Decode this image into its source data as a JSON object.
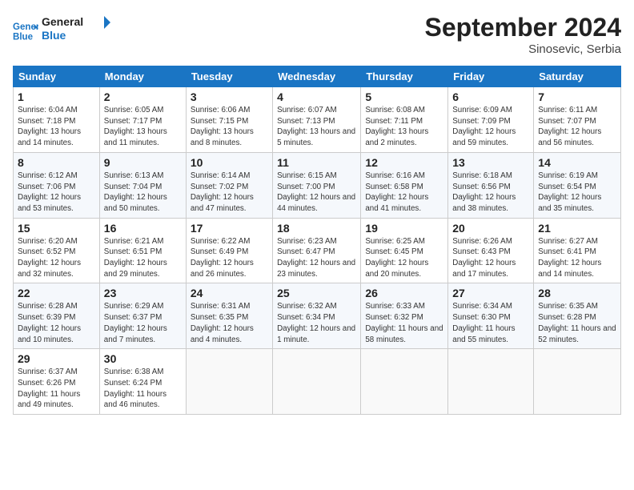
{
  "header": {
    "logo_line1": "General",
    "logo_line2": "Blue",
    "month": "September 2024",
    "location": "Sinosevic, Serbia"
  },
  "days_of_week": [
    "Sunday",
    "Monday",
    "Tuesday",
    "Wednesday",
    "Thursday",
    "Friday",
    "Saturday"
  ],
  "weeks": [
    [
      {
        "day": "1",
        "sunrise": "6:04 AM",
        "sunset": "7:18 PM",
        "daylight": "13 hours and 14 minutes."
      },
      {
        "day": "2",
        "sunrise": "6:05 AM",
        "sunset": "7:17 PM",
        "daylight": "13 hours and 11 minutes."
      },
      {
        "day": "3",
        "sunrise": "6:06 AM",
        "sunset": "7:15 PM",
        "daylight": "13 hours and 8 minutes."
      },
      {
        "day": "4",
        "sunrise": "6:07 AM",
        "sunset": "7:13 PM",
        "daylight": "13 hours and 5 minutes."
      },
      {
        "day": "5",
        "sunrise": "6:08 AM",
        "sunset": "7:11 PM",
        "daylight": "13 hours and 2 minutes."
      },
      {
        "day": "6",
        "sunrise": "6:09 AM",
        "sunset": "7:09 PM",
        "daylight": "12 hours and 59 minutes."
      },
      {
        "day": "7",
        "sunrise": "6:11 AM",
        "sunset": "7:07 PM",
        "daylight": "12 hours and 56 minutes."
      }
    ],
    [
      {
        "day": "8",
        "sunrise": "6:12 AM",
        "sunset": "7:06 PM",
        "daylight": "12 hours and 53 minutes."
      },
      {
        "day": "9",
        "sunrise": "6:13 AM",
        "sunset": "7:04 PM",
        "daylight": "12 hours and 50 minutes."
      },
      {
        "day": "10",
        "sunrise": "6:14 AM",
        "sunset": "7:02 PM",
        "daylight": "12 hours and 47 minutes."
      },
      {
        "day": "11",
        "sunrise": "6:15 AM",
        "sunset": "7:00 PM",
        "daylight": "12 hours and 44 minutes."
      },
      {
        "day": "12",
        "sunrise": "6:16 AM",
        "sunset": "6:58 PM",
        "daylight": "12 hours and 41 minutes."
      },
      {
        "day": "13",
        "sunrise": "6:18 AM",
        "sunset": "6:56 PM",
        "daylight": "12 hours and 38 minutes."
      },
      {
        "day": "14",
        "sunrise": "6:19 AM",
        "sunset": "6:54 PM",
        "daylight": "12 hours and 35 minutes."
      }
    ],
    [
      {
        "day": "15",
        "sunrise": "6:20 AM",
        "sunset": "6:52 PM",
        "daylight": "12 hours and 32 minutes."
      },
      {
        "day": "16",
        "sunrise": "6:21 AM",
        "sunset": "6:51 PM",
        "daylight": "12 hours and 29 minutes."
      },
      {
        "day": "17",
        "sunrise": "6:22 AM",
        "sunset": "6:49 PM",
        "daylight": "12 hours and 26 minutes."
      },
      {
        "day": "18",
        "sunrise": "6:23 AM",
        "sunset": "6:47 PM",
        "daylight": "12 hours and 23 minutes."
      },
      {
        "day": "19",
        "sunrise": "6:25 AM",
        "sunset": "6:45 PM",
        "daylight": "12 hours and 20 minutes."
      },
      {
        "day": "20",
        "sunrise": "6:26 AM",
        "sunset": "6:43 PM",
        "daylight": "12 hours and 17 minutes."
      },
      {
        "day": "21",
        "sunrise": "6:27 AM",
        "sunset": "6:41 PM",
        "daylight": "12 hours and 14 minutes."
      }
    ],
    [
      {
        "day": "22",
        "sunrise": "6:28 AM",
        "sunset": "6:39 PM",
        "daylight": "12 hours and 10 minutes."
      },
      {
        "day": "23",
        "sunrise": "6:29 AM",
        "sunset": "6:37 PM",
        "daylight": "12 hours and 7 minutes."
      },
      {
        "day": "24",
        "sunrise": "6:31 AM",
        "sunset": "6:35 PM",
        "daylight": "12 hours and 4 minutes."
      },
      {
        "day": "25",
        "sunrise": "6:32 AM",
        "sunset": "6:34 PM",
        "daylight": "12 hours and 1 minute."
      },
      {
        "day": "26",
        "sunrise": "6:33 AM",
        "sunset": "6:32 PM",
        "daylight": "11 hours and 58 minutes."
      },
      {
        "day": "27",
        "sunrise": "6:34 AM",
        "sunset": "6:30 PM",
        "daylight": "11 hours and 55 minutes."
      },
      {
        "day": "28",
        "sunrise": "6:35 AM",
        "sunset": "6:28 PM",
        "daylight": "11 hours and 52 minutes."
      }
    ],
    [
      {
        "day": "29",
        "sunrise": "6:37 AM",
        "sunset": "6:26 PM",
        "daylight": "11 hours and 49 minutes."
      },
      {
        "day": "30",
        "sunrise": "6:38 AM",
        "sunset": "6:24 PM",
        "daylight": "11 hours and 46 minutes."
      },
      null,
      null,
      null,
      null,
      null
    ]
  ]
}
